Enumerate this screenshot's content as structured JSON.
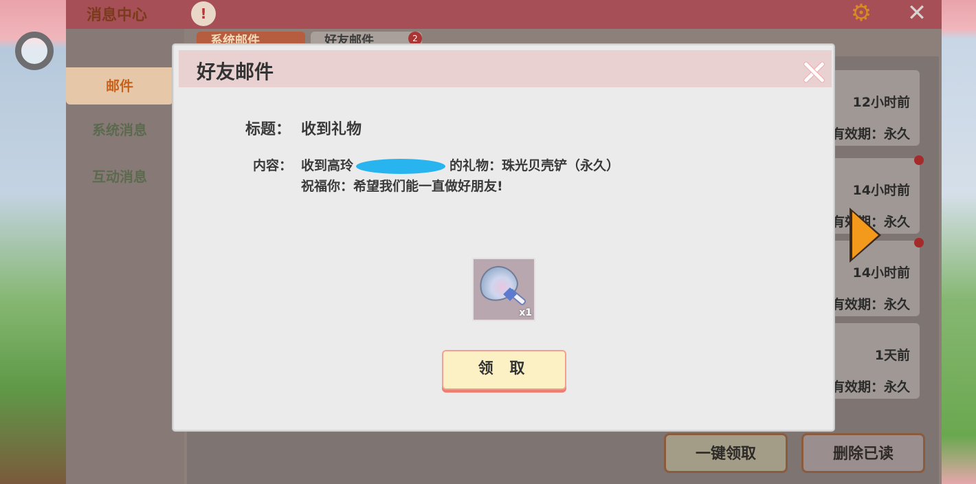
{
  "mail_center": {
    "title": "消息中心",
    "nav": [
      {
        "label": "邮件"
      },
      {
        "label": "系统消息"
      },
      {
        "label": "互动消息"
      }
    ],
    "tabs": [
      {
        "label": "系统邮件"
      },
      {
        "label": "好友邮件",
        "badge": "2"
      }
    ],
    "list_items": [
      {
        "time": "12小时前",
        "validity": "有效期：永久",
        "unread": false
      },
      {
        "time": "14小时前",
        "validity": "有效期：永久",
        "unread": true
      },
      {
        "time": "14小时前",
        "validity": "有效期：永久",
        "unread": true
      },
      {
        "time": "1天前",
        "validity": "有效期：永久",
        "unread": false
      }
    ],
    "buttons": {
      "collect_all": "一键领取",
      "delete_read": "删除已读"
    }
  },
  "dialog": {
    "title": "好友邮件",
    "subject_label": "标题：",
    "subject_value": "收到礼物",
    "content_label": "内容：",
    "content_line1_before": "收到高玲",
    "content_line1_after": "的礼物：珠光贝壳铲（永久）",
    "content_line2": "祝福你：希望我们能一直做好朋友!",
    "gift": {
      "icon": "pearl-shell-shovel-icon",
      "quantity": "x1"
    },
    "claim_button": "领 取"
  },
  "colors": {
    "accent": "#f39a1d",
    "dialog_header": "#e8d1d0",
    "claim_button": "#fbf1c5"
  }
}
